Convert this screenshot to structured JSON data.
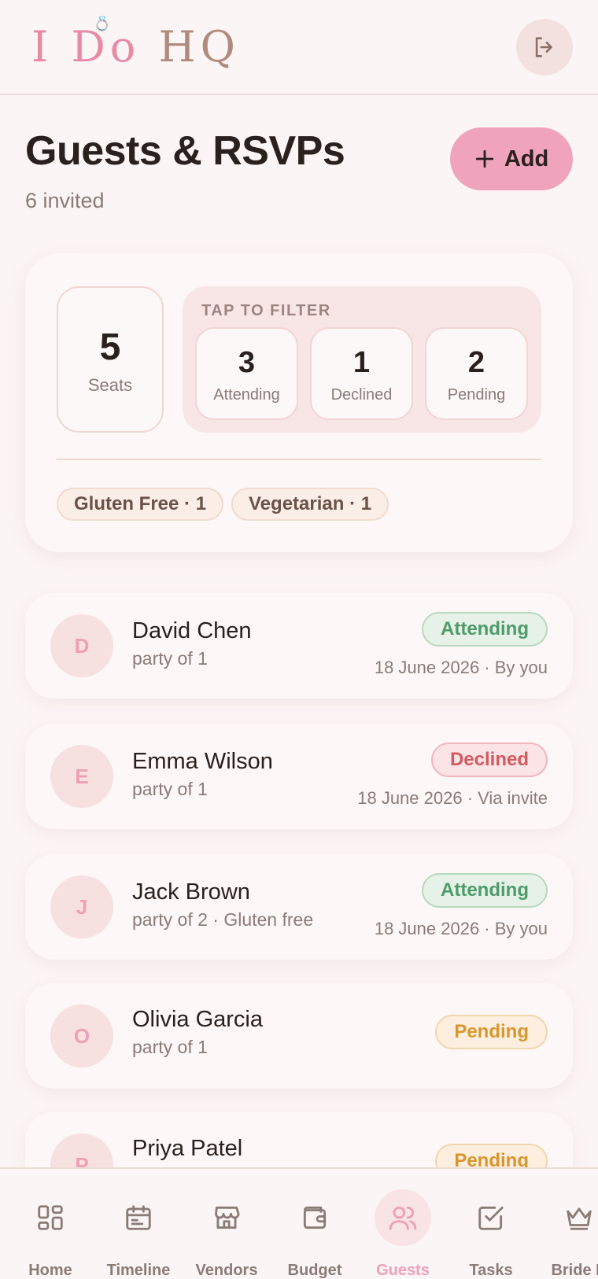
{
  "header": {
    "logo_i": "I",
    "logo_do": "Do",
    "logo_hq": "HQ"
  },
  "page": {
    "title": "Guests & RSVPs",
    "subtitle": "6 invited",
    "add_label": "Add"
  },
  "stats": {
    "seats_value": "5",
    "seats_label": "Seats",
    "filter_title": "TAP TO FILTER",
    "filters": [
      {
        "value": "3",
        "label": "Attending"
      },
      {
        "value": "1",
        "label": "Declined"
      },
      {
        "value": "2",
        "label": "Pending"
      }
    ],
    "dietary": [
      "Gluten Free · 1",
      "Vegetarian · 1"
    ]
  },
  "guests": [
    {
      "initial": "D",
      "name": "David Chen",
      "detail": "party of 1",
      "status": "Attending",
      "meta": "18 June 2026 · By you"
    },
    {
      "initial": "E",
      "name": "Emma Wilson",
      "detail": "party of 1",
      "status": "Declined",
      "meta": "18 June 2026 · Via invite"
    },
    {
      "initial": "J",
      "name": "Jack Brown",
      "detail": "party of 2 · Gluten free",
      "status": "Attending",
      "meta": "18 June 2026 · By you"
    },
    {
      "initial": "O",
      "name": "Olivia Garcia",
      "detail": "party of 1",
      "status": "Pending",
      "meta": ""
    },
    {
      "initial": "P",
      "name": "Priya Patel",
      "detail": "",
      "status": "Pending",
      "meta": ""
    }
  ],
  "nav": {
    "items": [
      {
        "label": "Home",
        "icon": "home-grid-icon"
      },
      {
        "label": "Timeline",
        "icon": "calendar-icon"
      },
      {
        "label": "Vendors",
        "icon": "store-icon"
      },
      {
        "label": "Budget",
        "icon": "wallet-icon"
      },
      {
        "label": "Guests",
        "icon": "users-icon"
      },
      {
        "label": "Tasks",
        "icon": "checkbox-icon"
      },
      {
        "label": "Bride H",
        "icon": "crown-icon"
      }
    ],
    "active": "Guests"
  },
  "colors": {
    "background": "#fcf5f5",
    "accent_pink": "#f0a3bd",
    "attending_green": "#4d9c68",
    "declined_red": "#d25a60",
    "pending_amber": "#d9962e"
  }
}
